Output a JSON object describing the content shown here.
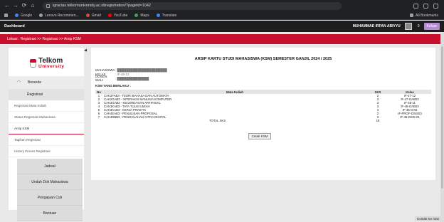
{
  "browser": {
    "url": "igracias.telkomuniversity.ac.id/registration/?pageid=1042",
    "nav": [
      "←",
      "→",
      "⟳",
      "⌂"
    ],
    "bookmarks": [
      {
        "label": "Google",
        "color": "#4285f4"
      },
      {
        "label": "Lenovo Recommen...",
        "color": "#9aa0a6"
      },
      {
        "label": "Gmail",
        "color": "#ea4335"
      },
      {
        "label": "YouTube",
        "color": "#ff0000"
      },
      {
        "label": "Maps",
        "color": "#34a853"
      },
      {
        "label": "Translate",
        "color": "#4285f4"
      }
    ],
    "all_bookmarks": "All Bookmarks"
  },
  "header": {
    "brand": "Dashboard",
    "user_name": "MUHAMMAD IRFAN ABIYYU",
    "notif_count": "0",
    "logout_label": "Keluar"
  },
  "breadcrumb": "Lokasi : Registrasi >> Registrasi >> Arsip KSM",
  "sidebar": {
    "logo_top": "Telkom",
    "logo_bottom": "University",
    "toggle": "◀",
    "main_items": [
      {
        "label": "Beranda"
      }
    ],
    "sub_head": "Registrasi",
    "links": [
      "Registrasi Mata Kuliah",
      "Status Registrasi Mahasiswa",
      "Arsip KSM",
      "Tagihan Registrasi",
      "History Proses Registrasi"
    ],
    "groups": [
      "Jadwal",
      "Unduh Dok Mahasiswa",
      "Pengajuan Cuti",
      "Bantuan"
    ]
  },
  "main": {
    "title": "ARSIP KARTU STUDI MAHASISWA (KSM) SEMESTER GANJIL 2024 / 2025",
    "info": [
      {
        "label": "MAHASISWA",
        "value": ": ██████████████████████"
      },
      {
        "label": "KELAS",
        "value": ": IF-48-12"
      },
      {
        "label": "DOSEN WALI",
        "value": ": ██████████████"
      }
    ],
    "ksm_label": "KSM YANG BERLAKU :",
    "columns": [
      "No",
      "Mata Kuliah",
      "SKS",
      "Kelas"
    ],
    "rows": [
      {
        "no": "1",
        "mk": "CAK2FAB3 - TEORI BAHASA DAN AUTOMATA",
        "sks": "2",
        "kelas": "IF-47-12"
      },
      {
        "no": "2",
        "mk": "CAK2GAB3 - INTERAKSI MANUSIA KOMPUTER",
        "sks": "3",
        "kelas": "IF-47-GAB03"
      },
      {
        "no": "3",
        "mk": "CAK3GAB3 - KECERDASAN ARTIFISIAL",
        "sks": "3",
        "kelas": "IF-48-11"
      },
      {
        "no": "4",
        "mk": "CAK3KAB3 - TATA TULIS ILMIAH",
        "sks": "3",
        "kelas": "IF-48-GAB03"
      },
      {
        "no": "5",
        "mk": "CAK3KAB3 - KERJA PRAKTIK",
        "sks": "3",
        "kelas": "IF-45-GAB"
      },
      {
        "no": "6",
        "mk": "CAK4EAB3 - PENULISAN PROPOSAL",
        "sks": "2",
        "kelas": "IF-PROF-DSIS03"
      },
      {
        "no": "7",
        "mk": "CAK4DBB3 - PENGOLAHAN CITRA DIGITAL",
        "sks": "3",
        "kelas": "IF-45-DSIS.01"
      }
    ],
    "total_label": "TOTAL SKS",
    "total_value": "19",
    "print_button": "Cetak KSM"
  },
  "footer": {
    "contact": "Kontak Ke Atas"
  }
}
